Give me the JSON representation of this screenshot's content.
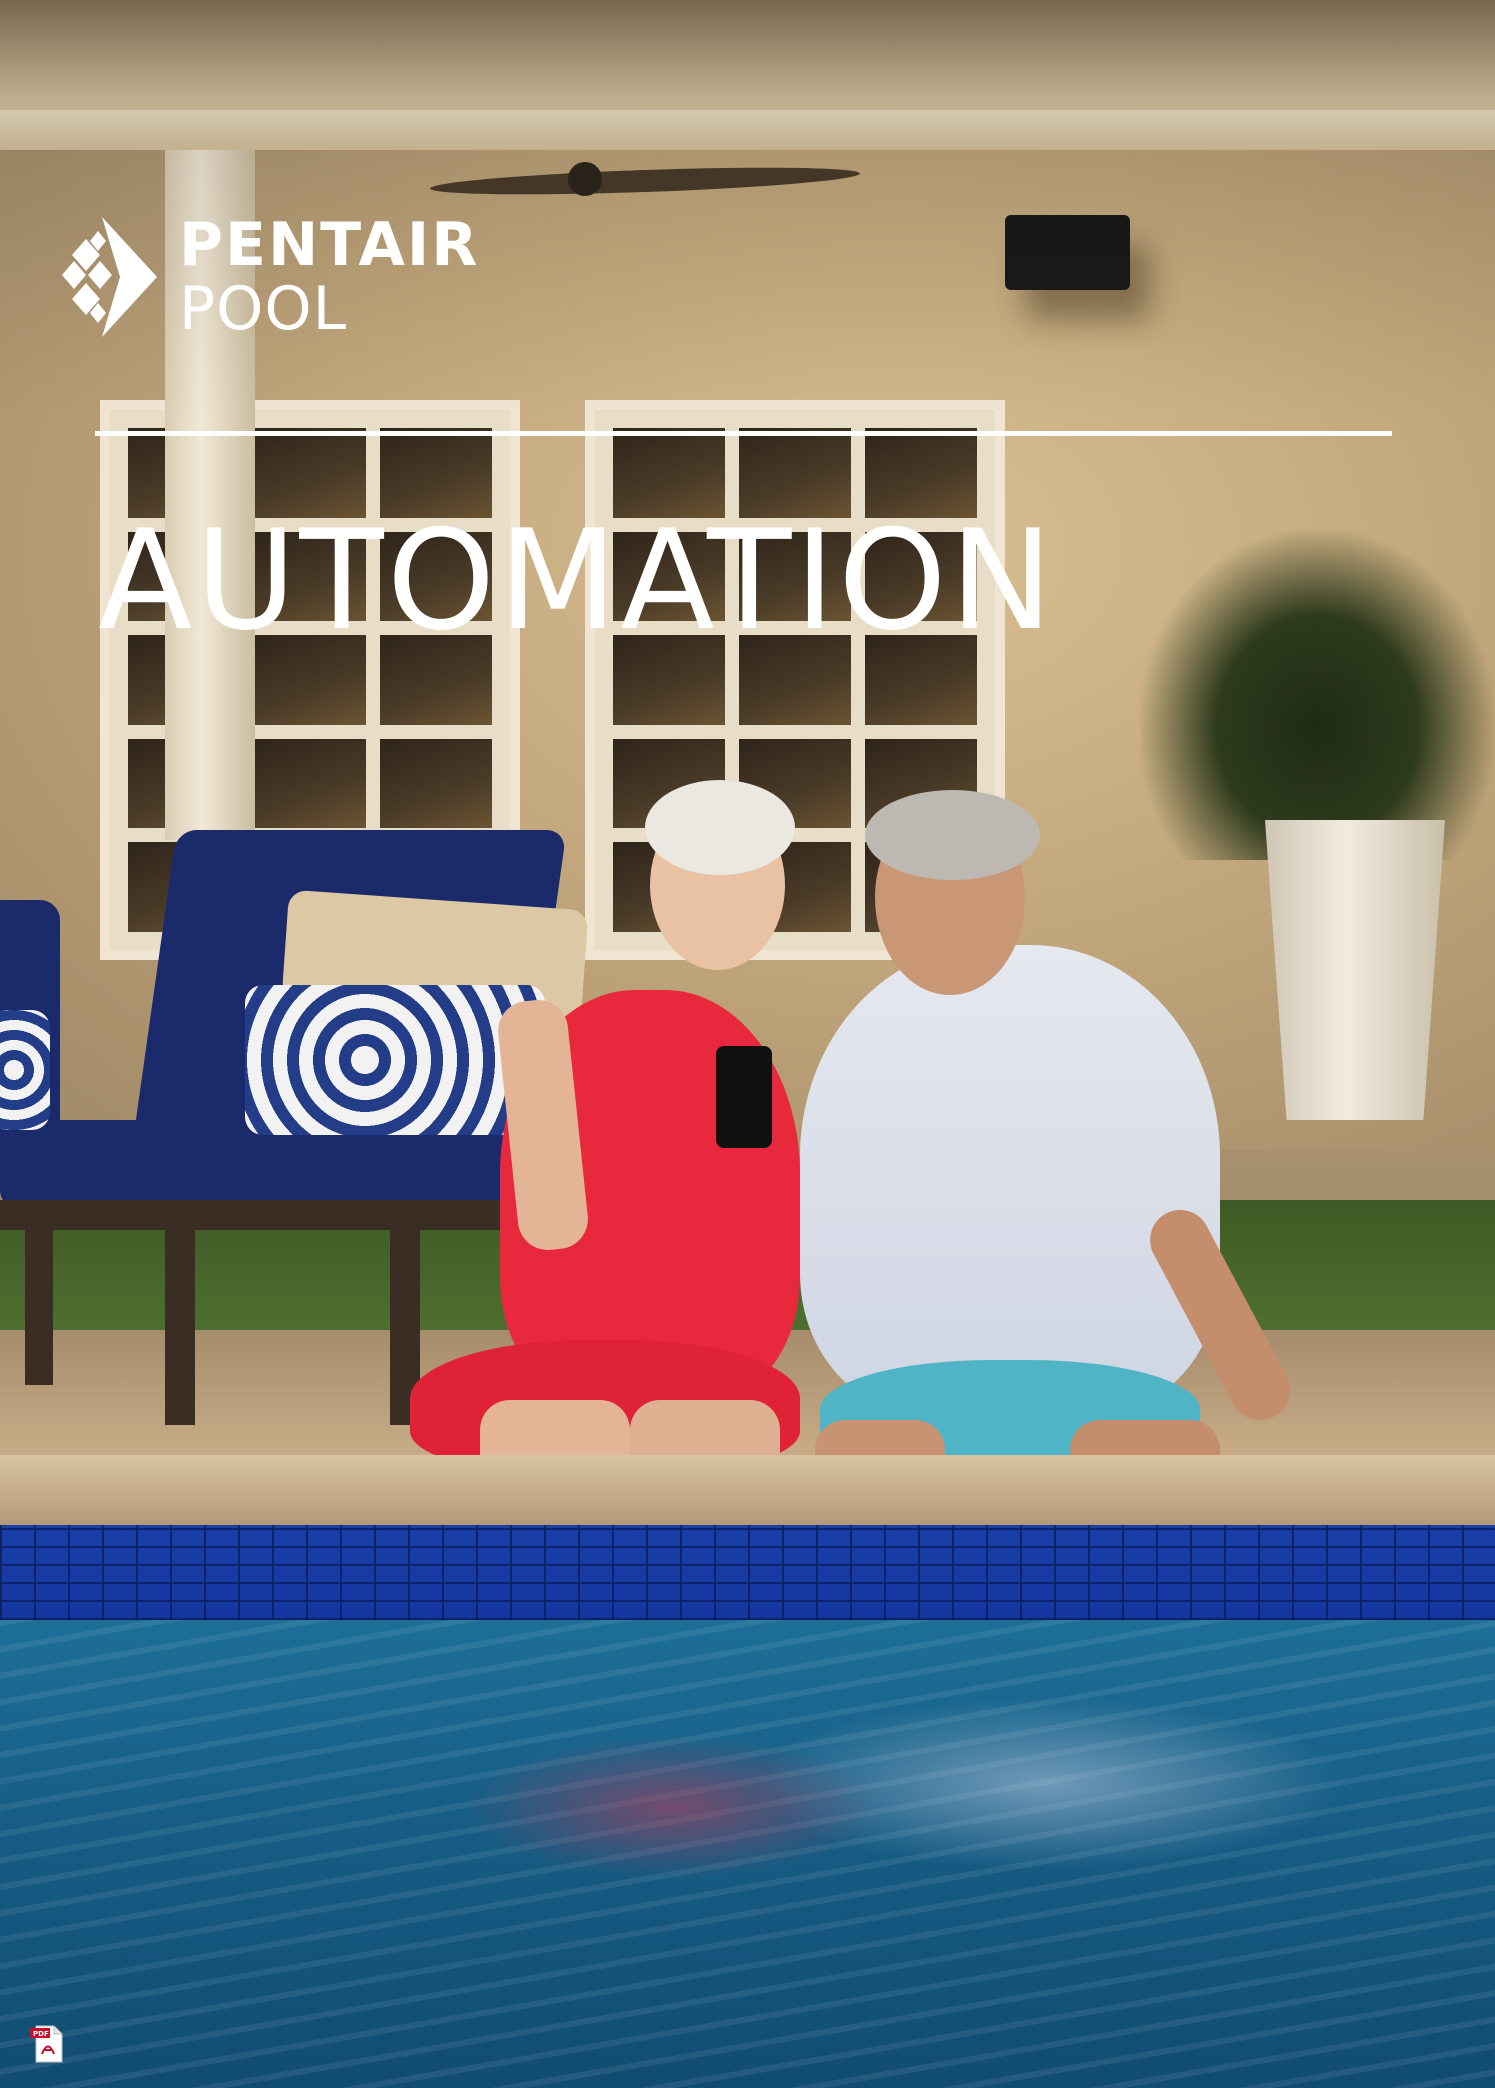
{
  "brand": {
    "line1": "PENTAIR",
    "line2": "POOL"
  },
  "title": "AUTOMATION",
  "colors": {
    "text": "#ffffff",
    "water": "#175e86",
    "tile": "#1a3fa8",
    "swimsuit": "#e8283c"
  },
  "icons": {
    "logo": "pentair-diamond-logo",
    "pdf": "adobe-pdf-icon"
  },
  "pdf_badge": "PDF"
}
